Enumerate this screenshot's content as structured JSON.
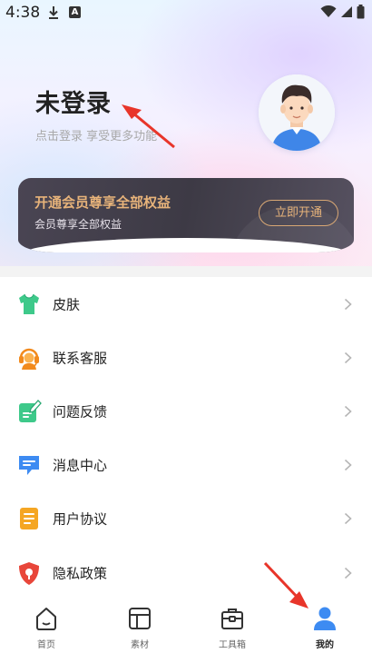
{
  "status_bar": {
    "time": "4:38"
  },
  "profile": {
    "title": "未登录",
    "subtitle": "点击登录 享受更多功能"
  },
  "vip": {
    "title": "开通会员尊享全部权益",
    "subtitle": "会员尊享全部权益",
    "button": "立即开通"
  },
  "menu": {
    "items": [
      {
        "label": "皮肤",
        "icon": "shirt-icon"
      },
      {
        "label": "联系客服",
        "icon": "headset-icon"
      },
      {
        "label": "问题反馈",
        "icon": "feedback-pen-icon"
      },
      {
        "label": "消息中心",
        "icon": "message-icon"
      },
      {
        "label": "用户协议",
        "icon": "document-icon"
      },
      {
        "label": "隐私政策",
        "icon": "privacy-shield-icon"
      }
    ]
  },
  "nav": {
    "tabs": [
      {
        "label": "首页",
        "icon": "home-icon"
      },
      {
        "label": "素材",
        "icon": "material-icon"
      },
      {
        "label": "工具箱",
        "icon": "toolbox-icon"
      },
      {
        "label": "我的",
        "icon": "person-icon",
        "active": true
      }
    ]
  },
  "colors": {
    "accent": "#3d8bf2",
    "vip_gold": "#e7b37a",
    "arrow": "#e8352a"
  }
}
